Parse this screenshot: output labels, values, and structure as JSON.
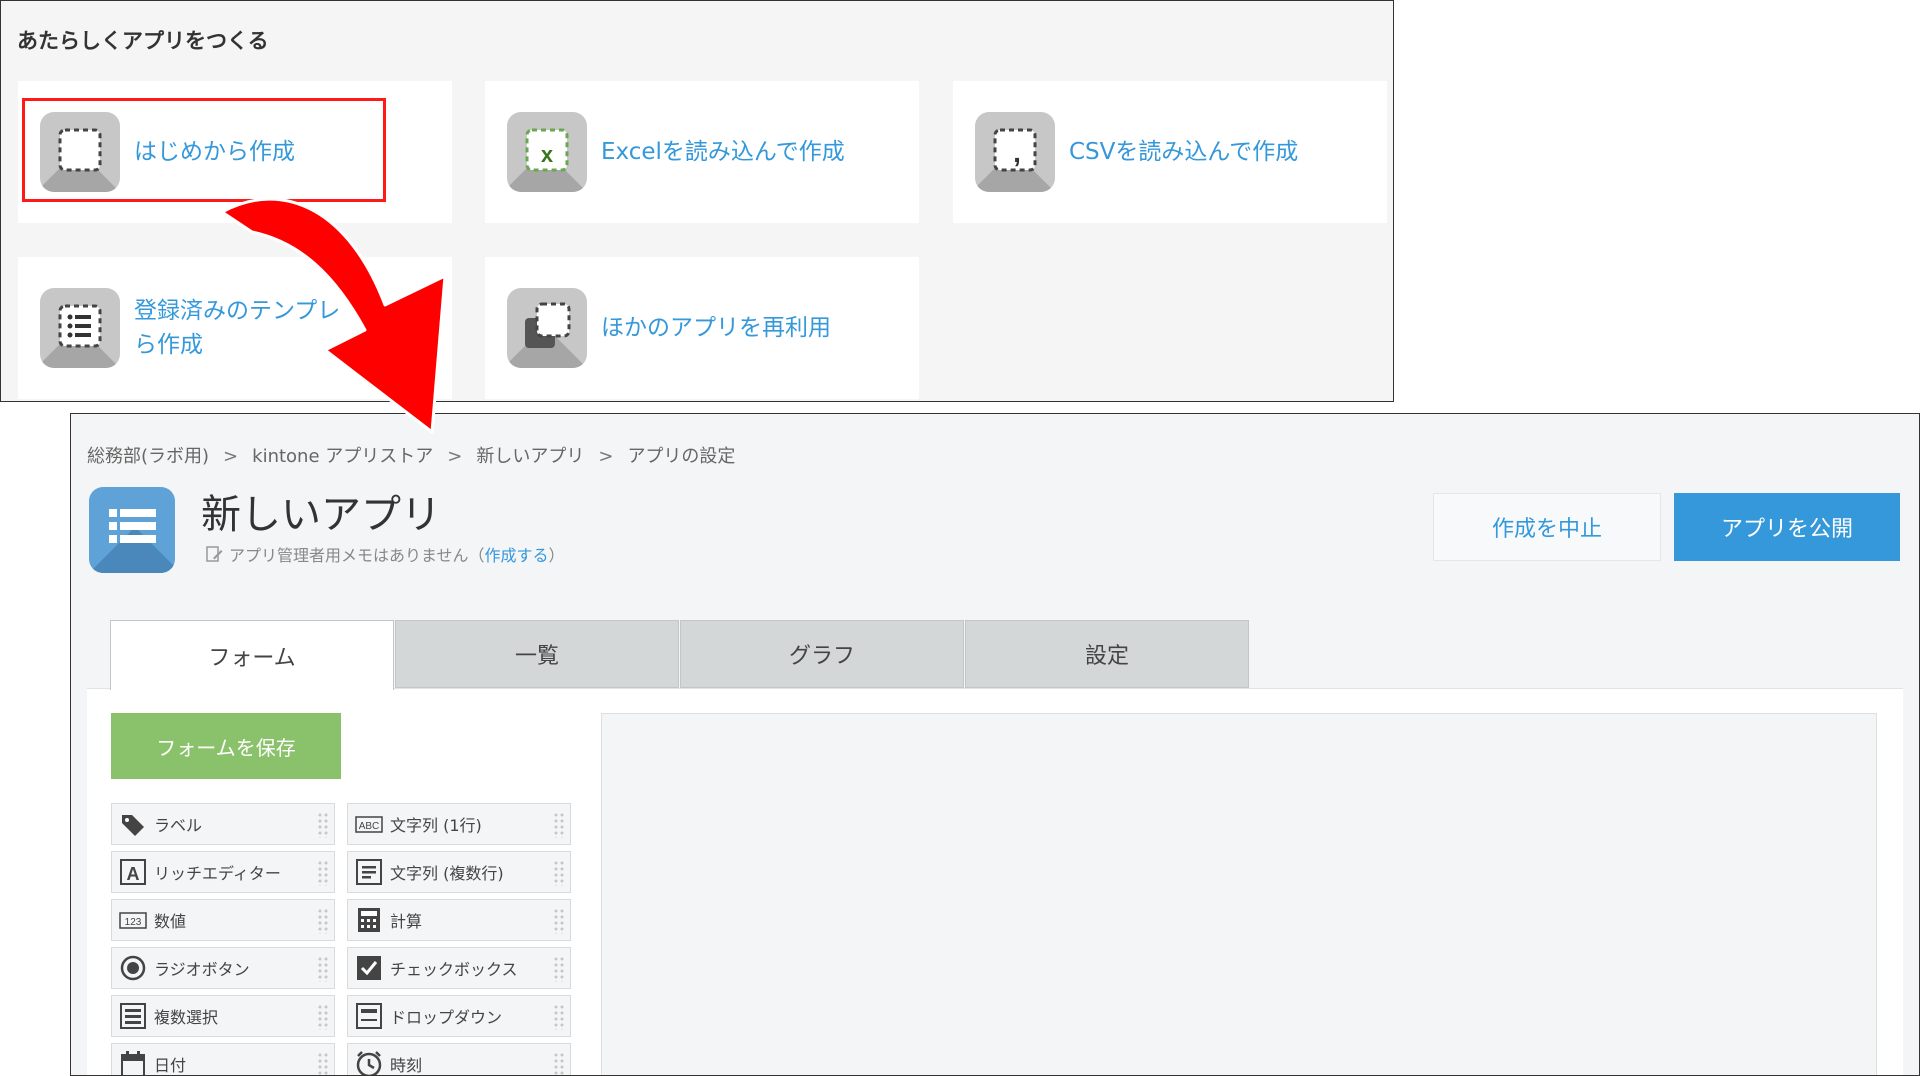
{
  "new_app": {
    "heading": "あたらしくアプリをつくる",
    "options": [
      {
        "label": "はじめから作成",
        "icon": "dashed-square-icon"
      },
      {
        "label": "Excelを読み込んで作成",
        "icon": "excel-file-icon"
      },
      {
        "label": "CSVを読み込んで作成",
        "icon": "csv-file-icon"
      },
      {
        "label": "登録済みのテンプレートから作成",
        "line1": "登録済みのテンプレ",
        "line2": "ら作成",
        "icon": "template-list-icon"
      },
      {
        "label": "ほかのアプリを再利用",
        "icon": "reuse-app-icon"
      }
    ]
  },
  "app_settings": {
    "breadcrumb": [
      "総務部(ラボ用)",
      "kintone アプリストア",
      "新しいアプリ",
      "アプリの設定"
    ],
    "breadcrumb_separator": ">",
    "title": "新しいアプリ",
    "memo_text": "アプリ管理者用メモはありません（",
    "memo_link": "作成する",
    "memo_close": "）",
    "cancel_label": "作成を中止",
    "publish_label": "アプリを公開",
    "tabs": [
      "フォーム",
      "一覧",
      "グラフ",
      "設定"
    ],
    "active_tab": "フォーム",
    "save_form_label": "フォームを保存",
    "fields": [
      {
        "label": "ラベル",
        "icon": "tag-icon"
      },
      {
        "label": "文字列 (1行)",
        "icon": "abc-text-icon"
      },
      {
        "label": "リッチエディター",
        "icon": "rich-editor-icon"
      },
      {
        "label": "文字列 (複数行)",
        "icon": "multiline-text-icon"
      },
      {
        "label": "数値",
        "icon": "number-icon"
      },
      {
        "label": "計算",
        "icon": "calculator-icon"
      },
      {
        "label": "ラジオボタン",
        "icon": "radio-icon"
      },
      {
        "label": "チェックボックス",
        "icon": "checkbox-icon"
      },
      {
        "label": "複数選択",
        "icon": "multi-select-icon"
      },
      {
        "label": "ドロップダウン",
        "icon": "dropdown-icon"
      },
      {
        "label": "日付",
        "icon": "calendar-icon"
      },
      {
        "label": "時刻",
        "icon": "clock-icon"
      }
    ]
  },
  "colors": {
    "link_blue": "#3498db",
    "publish_blue": "#3498db",
    "save_green": "#8ac26b",
    "highlight_red": "#ff1a1a",
    "arrow_red": "#ff0000"
  }
}
